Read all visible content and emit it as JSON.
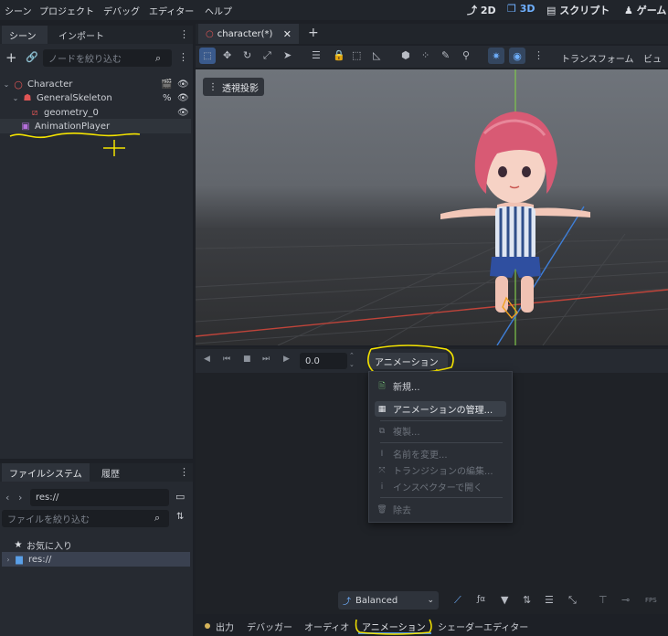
{
  "menubar": {
    "items": [
      "シーン",
      "プロジェクト",
      "デバッグ",
      "エディター",
      "ヘルプ"
    ],
    "modes": {
      "mode_2d": "2D",
      "mode_3d": "3D",
      "script": "スクリプト",
      "game": "ゲーム"
    }
  },
  "scene_dock": {
    "tabs": [
      "シーン",
      "インポート"
    ],
    "filter_placeholder": "ノードを絞り込む",
    "tree": [
      {
        "label": "Character",
        "icon": "node3d-icon",
        "color": "#e05555"
      },
      {
        "label": "GeneralSkeleton",
        "icon": "skeleton-icon",
        "color": "#e05555"
      },
      {
        "label": "geometry_0",
        "icon": "mesh-icon",
        "color": "#e05555"
      },
      {
        "label": "AnimationPlayer",
        "icon": "animation-player-icon",
        "color": "#b66fdc"
      }
    ]
  },
  "filesystem": {
    "tabs": [
      "ファイルシステム",
      "履歴"
    ],
    "path": "res://",
    "filter_placeholder": "ファイルを絞り込む",
    "favorites": "お気に入り",
    "root": "res://"
  },
  "editor": {
    "tab": "character(*)",
    "transform_label": "トランスフォーム",
    "view_label": "ビュー",
    "perspective_label": "透視投影"
  },
  "animation_panel": {
    "time_value": "0.0",
    "animation_button": "アニメーション",
    "menu": [
      {
        "label": "新規...",
        "icon": "new-icon",
        "disabled": false
      },
      {
        "label": "アニメーションの管理...",
        "icon": "library-icon",
        "disabled": false
      },
      {
        "label": "複製...",
        "icon": "duplicate-icon",
        "disabled": true
      },
      {
        "label": "名前を変更...",
        "icon": "rename-icon",
        "disabled": true
      },
      {
        "label": "トランジションの編集...",
        "icon": "transition-icon",
        "disabled": true
      },
      {
        "label": "インスペクターで開く",
        "icon": "info-icon",
        "disabled": true
      },
      {
        "label": "除去",
        "icon": "trash-icon",
        "disabled": true
      }
    ],
    "snap_mode": "Balanced",
    "fps_label": "FPS"
  },
  "bottom_tabs": [
    "出力",
    "デバッガー",
    "オーディオ",
    "アニメーション",
    "シェーダーエディター"
  ],
  "colors": {
    "accent": "#4a90e2",
    "annotation": "#f4e300",
    "node_red": "#e05555"
  }
}
